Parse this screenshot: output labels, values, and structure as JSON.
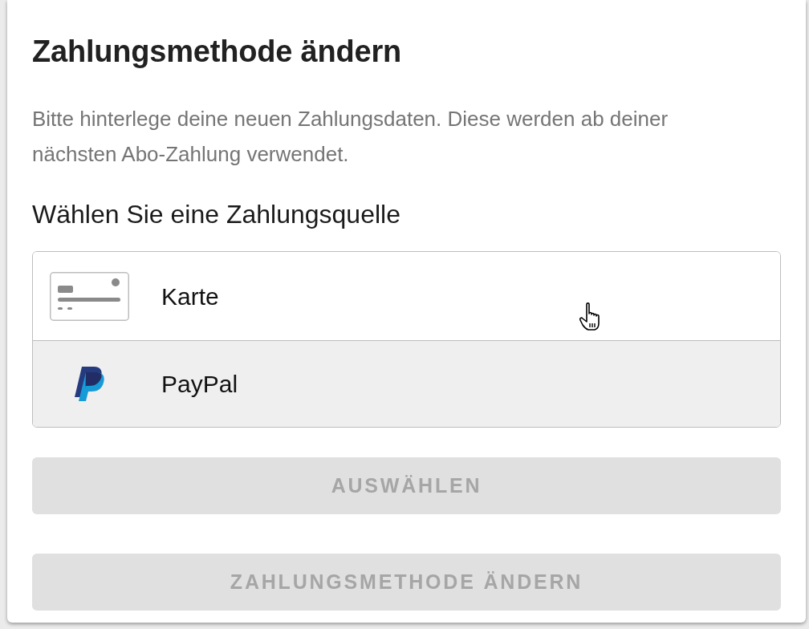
{
  "dialog": {
    "title": "Zahlungsmethode ändern",
    "description": "Bitte hinterlege deine neuen Zahlungsdaten. Diese werden ab deiner nächsten Abo-Zahlung verwendet.",
    "source_label": "Wählen Sie eine Zahlungsquelle",
    "sources": [
      {
        "kind": "card",
        "label": "Karte",
        "highlighted": false
      },
      {
        "kind": "paypal",
        "label": "PayPal",
        "highlighted": true
      }
    ],
    "buttons": [
      {
        "label": "AUSWÄHLEN",
        "disabled": true
      },
      {
        "label": "ZAHLUNGSMETHODE ÄNDERN",
        "disabled": true
      }
    ]
  }
}
